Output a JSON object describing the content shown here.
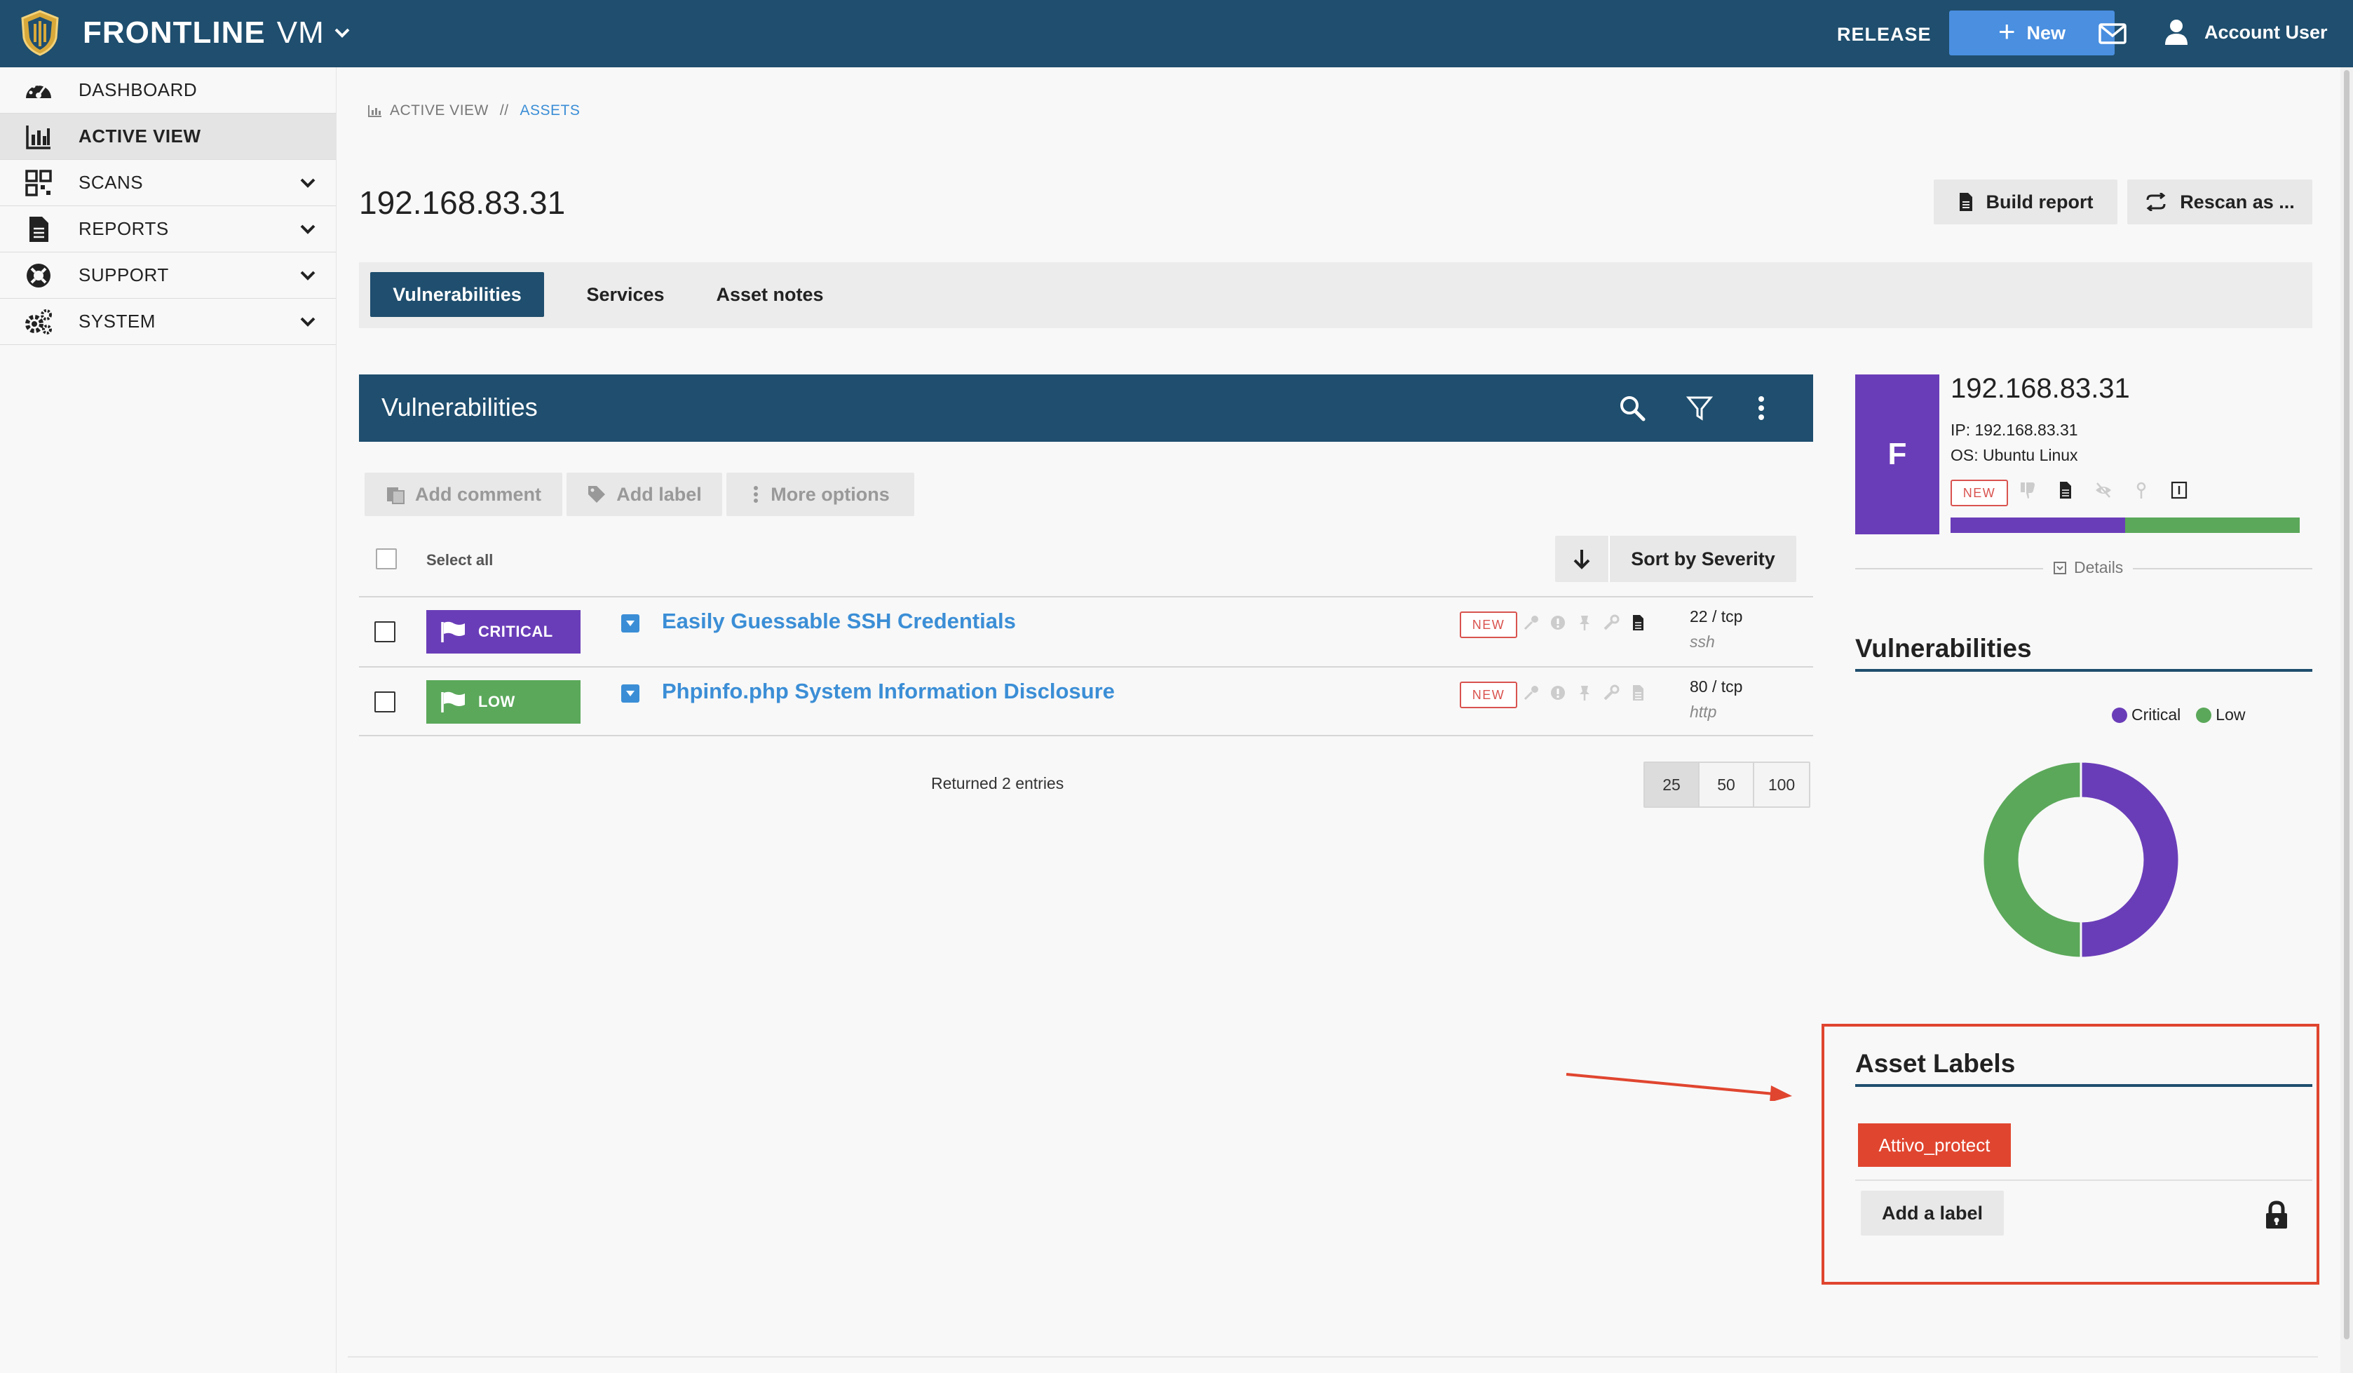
{
  "topbar": {
    "brand": "FRONTLINE",
    "brand_suffix": "VM",
    "release": "RELEASE",
    "new_label": "New",
    "account": "Account User"
  },
  "sidebar": {
    "items": [
      {
        "label": "DASHBOARD",
        "icon": "gauge-icon",
        "active": false,
        "expandable": false
      },
      {
        "label": "ACTIVE VIEW",
        "icon": "bar-chart-icon",
        "active": true,
        "expandable": false
      },
      {
        "label": "SCANS",
        "icon": "qr-grid-icon",
        "active": false,
        "expandable": true
      },
      {
        "label": "REPORTS",
        "icon": "document-icon",
        "active": false,
        "expandable": true
      },
      {
        "label": "SUPPORT",
        "icon": "lifebuoy-icon",
        "active": false,
        "expandable": true
      },
      {
        "label": "SYSTEM",
        "icon": "gears-icon",
        "active": false,
        "expandable": true
      }
    ]
  },
  "breadcrumb": {
    "root": "ACTIVE VIEW",
    "separator": "//",
    "current": "ASSETS"
  },
  "page": {
    "title": "192.168.83.31",
    "build_report": "Build report",
    "rescan": "Rescan as ..."
  },
  "tabs": [
    {
      "label": "Vulnerabilities",
      "active": true
    },
    {
      "label": "Services",
      "active": false
    },
    {
      "label": "Asset notes",
      "active": false
    }
  ],
  "vulnerabilities": {
    "title": "Vulnerabilities",
    "actions": {
      "add_comment": "Add comment",
      "add_label": "Add label",
      "more_options": "More options"
    },
    "select_all": "Select all",
    "sort_label": "Sort by Severity",
    "rows": [
      {
        "severity": "CRITICAL",
        "name": "Easily Guessable SSH Credentials",
        "badge": "NEW",
        "port": "22 / tcp",
        "protocol": "ssh"
      },
      {
        "severity": "LOW",
        "name": "Phpinfo.php System Information Disclosure",
        "badge": "NEW",
        "port": "80 / tcp",
        "protocol": "http"
      }
    ],
    "returned": "Returned 2 entries",
    "page_sizes": [
      "25",
      "50",
      "100"
    ],
    "selected_page_size": "25"
  },
  "asset": {
    "grade": "F",
    "name": "192.168.83.31",
    "ip": "IP: 192.168.83.31",
    "os": "OS: Ubuntu Linux",
    "badge": "NEW",
    "details": "Details",
    "severity_split": {
      "critical": 0.5,
      "low": 0.5
    }
  },
  "vuln_chart": {
    "title": "Vulnerabilities",
    "legend": [
      "Critical",
      "Low"
    ]
  },
  "chart_data": {
    "type": "pie",
    "categories": [
      "Critical",
      "Low"
    ],
    "values": [
      1,
      1
    ],
    "title": "Vulnerabilities"
  },
  "asset_labels": {
    "title": "Asset Labels",
    "labels": [
      "Attivo_protect"
    ],
    "add_label": "Add a label"
  },
  "colors": {
    "header": "#1f4e6e",
    "accent": "#4a8fe0",
    "link": "#3b8ed6",
    "critical": "#6a3db8",
    "low": "#5ba85a",
    "label_red": "#e0452f"
  }
}
